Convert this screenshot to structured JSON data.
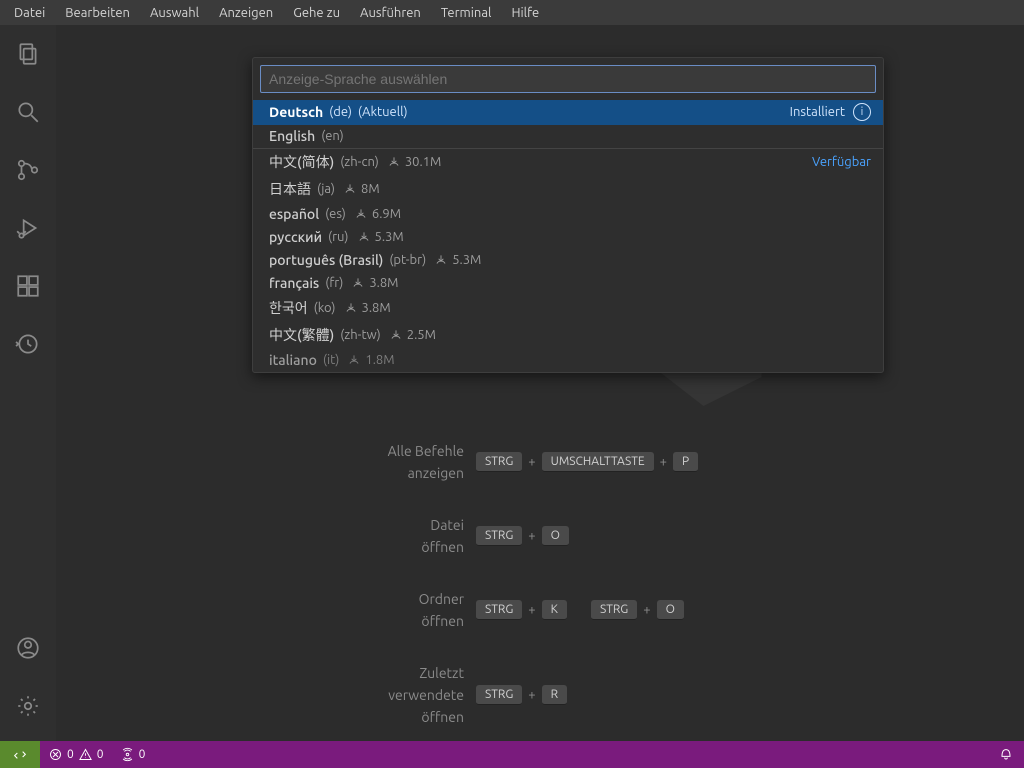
{
  "menubar": [
    "Datei",
    "Bearbeiten",
    "Auswahl",
    "Anzeigen",
    "Gehe zu",
    "Ausführen",
    "Terminal",
    "Hilfe"
  ],
  "quickpick": {
    "placeholder": "Anzeige-Sprache auswählen",
    "installed_badge": "Installiert",
    "available_label": "Verfügbar",
    "items": [
      {
        "name": "Deutsch",
        "code": "(de)",
        "extra": "(Aktuell)",
        "right": "installed",
        "selected": true
      },
      {
        "name": "English",
        "code": "(en)"
      },
      {
        "divider": true
      },
      {
        "name": "中文(简体)",
        "code": "(zh-cn)",
        "downloads": "30.1M",
        "right": "available"
      },
      {
        "name": "日本語",
        "code": "(ja)",
        "downloads": "8M"
      },
      {
        "name": "español",
        "code": "(es)",
        "downloads": "6.9M"
      },
      {
        "name": "русский",
        "code": "(ru)",
        "downloads": "5.3M"
      },
      {
        "name": "português (Brasil)",
        "code": "(pt-br)",
        "downloads": "5.3M"
      },
      {
        "name": "français",
        "code": "(fr)",
        "downloads": "3.8M"
      },
      {
        "name": "한국어",
        "code": "(ko)",
        "downloads": "3.8M"
      },
      {
        "name": "中文(繁體)",
        "code": "(zh-tw)",
        "downloads": "2.5M"
      },
      {
        "name": "italiano",
        "code": "(it)",
        "downloads": "1.8M",
        "truncated": true
      }
    ]
  },
  "hints": [
    {
      "label": "Alle Befehle\nanzeigen",
      "keys": [
        [
          "STRG",
          "UMSCHALTTASTE",
          "P"
        ]
      ]
    },
    {
      "label": "Datei\nöffnen",
      "keys": [
        [
          "STRG",
          "O"
        ]
      ]
    },
    {
      "label": "Ordner\nöffnen",
      "keys": [
        [
          "STRG",
          "K"
        ],
        [
          "STRG",
          "O"
        ]
      ]
    },
    {
      "label": "Zuletzt\nverwendete\nöffnen",
      "keys": [
        [
          "STRG",
          "R"
        ]
      ]
    }
  ],
  "statusbar": {
    "errors": "0",
    "warnings": "0",
    "ports": "0"
  },
  "activitybar": {
    "top": [
      "explorer-icon",
      "search-icon",
      "source-control-icon",
      "run-debug-icon",
      "extensions-icon",
      "history-icon"
    ],
    "bottom": [
      "account-icon",
      "settings-gear-icon"
    ]
  }
}
